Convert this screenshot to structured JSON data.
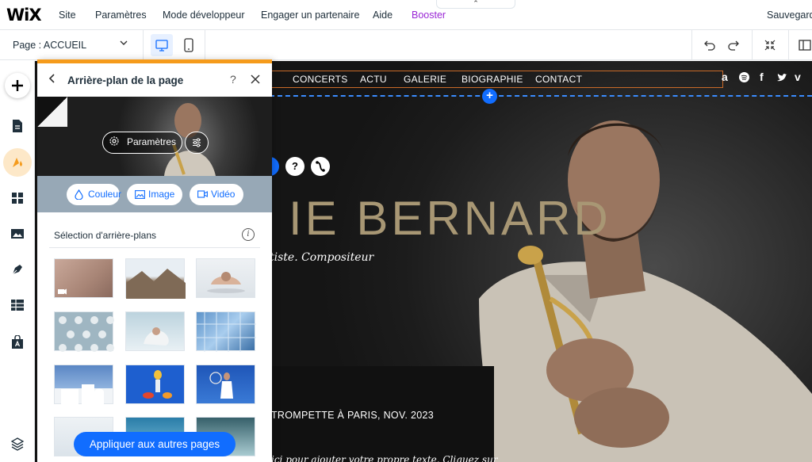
{
  "topbar": {
    "logo": "WiX",
    "menu": [
      "Site",
      "Paramètres",
      "Mode développeur",
      "Engager un partenaire",
      "Aide",
      "Booster"
    ],
    "save": "Sauvegard"
  },
  "subbar": {
    "page_selector": "Page : ACCUEIL"
  },
  "site": {
    "nav": [
      "CONCERTS",
      "ACTU",
      "GALERIE",
      "BIOGRAPHIE",
      "CONTACT"
    ],
    "social_icons": [
      "amazon-icon",
      "spotify-icon",
      "facebook-icon",
      "twitter-icon",
      "vimeo-icon"
    ],
    "hero_title": "IE BERNARD",
    "hero_subtitle": "tiste. Compositeur",
    "event_text": "TROMPETTE À PARIS, NOV. 2023",
    "body_text": "ici pour ajouter votre propre texte. Cliquez sur",
    "nav_border_color": "#c96a28",
    "title_color": "#a89774"
  },
  "panel": {
    "title": "Arrière-plan de la page",
    "help": "?",
    "settings_button": "Paramètres",
    "media_buttons": [
      "Couleur",
      "Image",
      "Vidéo"
    ],
    "section_title": "Sélection d'arrière-plans",
    "apply_button": "Appliquer aux autres pages",
    "accent_color": "#f59b1c",
    "primary_color": "#116dff"
  }
}
